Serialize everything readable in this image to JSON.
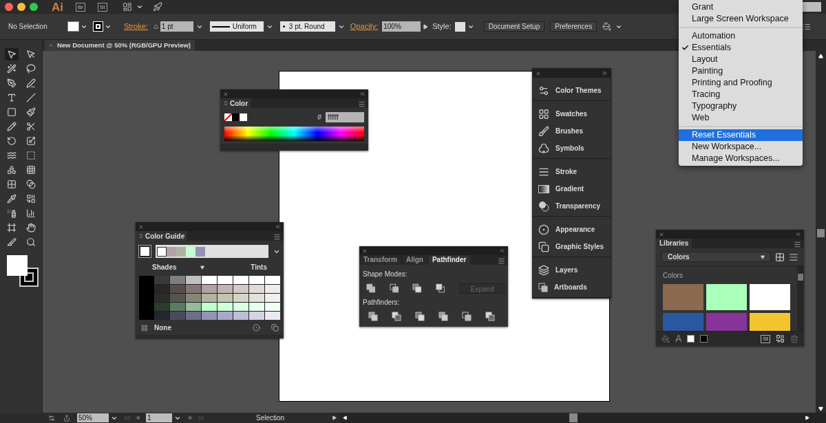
{
  "app_bar": {
    "logo": "Ai",
    "badges": [
      "Br",
      "St"
    ]
  },
  "control_bar": {
    "selection": "No Selection",
    "stroke_label": "Stroke:",
    "stroke_weight": "1 pt",
    "profile": "Uniform",
    "brush": "3 pt. Round",
    "opacity_label": "Opacity:",
    "opacity": "100%",
    "style_label": "Style:",
    "buttons": [
      "Document Setup",
      "Preferences"
    ]
  },
  "document_tab": {
    "title": "New Document @ 50% (RGB/GPU Preview)"
  },
  "tools": [
    {
      "selected": true
    },
    {
      "selected": false
    },
    {
      "selected": false
    },
    {
      "selected": false
    },
    {
      "selected": false
    },
    {
      "selected": false
    },
    {
      "selected": false
    },
    {
      "selected": false
    },
    {
      "selected": false
    },
    {
      "selected": false
    },
    {
      "selected": false
    },
    {
      "selected": false
    },
    {
      "selected": false
    },
    {
      "selected": false
    },
    {
      "selected": false
    },
    {
      "selected": false
    },
    {
      "selected": false
    },
    {
      "selected": false
    },
    {
      "selected": false
    },
    {
      "selected": false
    },
    {
      "selected": false
    },
    {
      "selected": false
    },
    {
      "selected": false
    },
    {
      "selected": false
    },
    {
      "selected": false
    },
    {
      "selected": false
    },
    {
      "selected": false
    },
    {
      "selected": false
    }
  ],
  "color_panel": {
    "tab": "Color",
    "hex_label": "#",
    "hex": "ffffff"
  },
  "color_guide": {
    "tab": "Color Guide",
    "harmony": [
      {
        "color": "#ffffff"
      },
      {
        "color": "#b3a2a2"
      },
      {
        "color": "#b2b2a2"
      },
      {
        "color": "#c2ffd0"
      },
      {
        "color": "#9393b4"
      }
    ],
    "shades_label": "Shades",
    "tints_label": "Tints",
    "grid": [
      [
        {
          "color": "#3a3a3a"
        },
        {
          "color": "#7f7f7f"
        },
        {
          "color": "#c0c0c0"
        },
        {
          "color": "#ffffff"
        },
        {
          "color": "#ffffff"
        },
        {
          "color": "#ffffff"
        },
        {
          "color": "#ffffff"
        },
        {
          "color": "#ffffff"
        }
      ],
      [
        {
          "color": "#2b2626"
        },
        {
          "color": "#574e4e"
        },
        {
          "color": "#857676"
        },
        {
          "color": "#b3a2a2"
        },
        {
          "color": "#c4b3b3"
        },
        {
          "color": "#d4c8c8"
        },
        {
          "color": "#e2dada"
        },
        {
          "color": "#f0ecec"
        }
      ],
      [
        {
          "color": "#2c2c28"
        },
        {
          "color": "#55554e"
        },
        {
          "color": "#868678"
        },
        {
          "color": "#b2b2a2"
        },
        {
          "color": "#c3c3b3"
        },
        {
          "color": "#d4d4c8"
        },
        {
          "color": "#e2e2da"
        },
        {
          "color": "#f0f0ec"
        }
      ],
      [
        {
          "color": "#2b3b2e"
        },
        {
          "color": "#5b7a62"
        },
        {
          "color": "#93bb9c"
        },
        {
          "color": "#c2ffd0"
        },
        {
          "color": "#d0ffdc"
        },
        {
          "color": "#dcffe5"
        },
        {
          "color": "#e8ffee"
        },
        {
          "color": "#f3fff6"
        }
      ],
      [
        {
          "color": "#25252e"
        },
        {
          "color": "#4a4a5c"
        },
        {
          "color": "#6e6e88"
        },
        {
          "color": "#9393b4"
        },
        {
          "color": "#a8a8c8"
        },
        {
          "color": "#bdbdd6"
        },
        {
          "color": "#d3d3e3"
        },
        {
          "color": "#e9e9f1"
        }
      ]
    ],
    "footer": "None"
  },
  "pathfinder_panel": {
    "tabs": [
      {
        "label": "Transform",
        "selected": false
      },
      {
        "label": "Align",
        "selected": false
      },
      {
        "label": "Pathfinder",
        "selected": true
      }
    ],
    "shape_modes_label": "Shape Modes:",
    "expand_button": {
      "label": "Expand",
      "disabled": true
    },
    "pathfinders_label": "Pathfinders:"
  },
  "dock": {
    "groups": [
      [
        "Color Themes"
      ],
      [
        "Swatches",
        "Brushes",
        "Symbols"
      ],
      [
        "Stroke",
        "Gradient",
        "Transparency"
      ],
      [
        "Appearance",
        "Graphic Styles"
      ],
      [
        "Layers",
        "Artboards"
      ]
    ]
  },
  "libraries_panel": {
    "tab": "Libraries",
    "library": "Colors",
    "section": "Colors",
    "swatches": [
      {
        "color": "#8b6a50"
      },
      {
        "color": "#aaffbb"
      },
      {
        "color": "#ffffff"
      },
      {
        "color": "#2a58a0"
      },
      {
        "color": "#883399"
      },
      {
        "color": "#f4c430"
      }
    ],
    "text_style_icon": "A",
    "stock_badge": "St"
  },
  "workspace_menu": {
    "groups": [
      [
        {
          "label": "Grant",
          "checked": false,
          "selected": false
        },
        {
          "label": "Large Screen Workspace",
          "checked": false,
          "selected": false
        }
      ],
      [
        {
          "label": "Automation",
          "checked": false,
          "selected": false
        },
        {
          "label": "Essentials",
          "checked": true,
          "selected": false
        },
        {
          "label": "Layout",
          "checked": false,
          "selected": false
        },
        {
          "label": "Painting",
          "checked": false,
          "selected": false
        },
        {
          "label": "Printing and Proofing",
          "checked": false,
          "selected": false
        },
        {
          "label": "Tracing",
          "checked": false,
          "selected": false
        },
        {
          "label": "Typography",
          "checked": false,
          "selected": false
        },
        {
          "label": "Web",
          "checked": false,
          "selected": false
        }
      ],
      [
        {
          "label": "Reset Essentials",
          "checked": false,
          "selected": true
        },
        {
          "label": "New Workspace...",
          "checked": false,
          "selected": false
        },
        {
          "label": "Manage Workspaces...",
          "checked": false,
          "selected": false
        }
      ]
    ]
  },
  "status_bar": {
    "zoom": "50%",
    "artboard": "1",
    "tool": "Selection"
  }
}
